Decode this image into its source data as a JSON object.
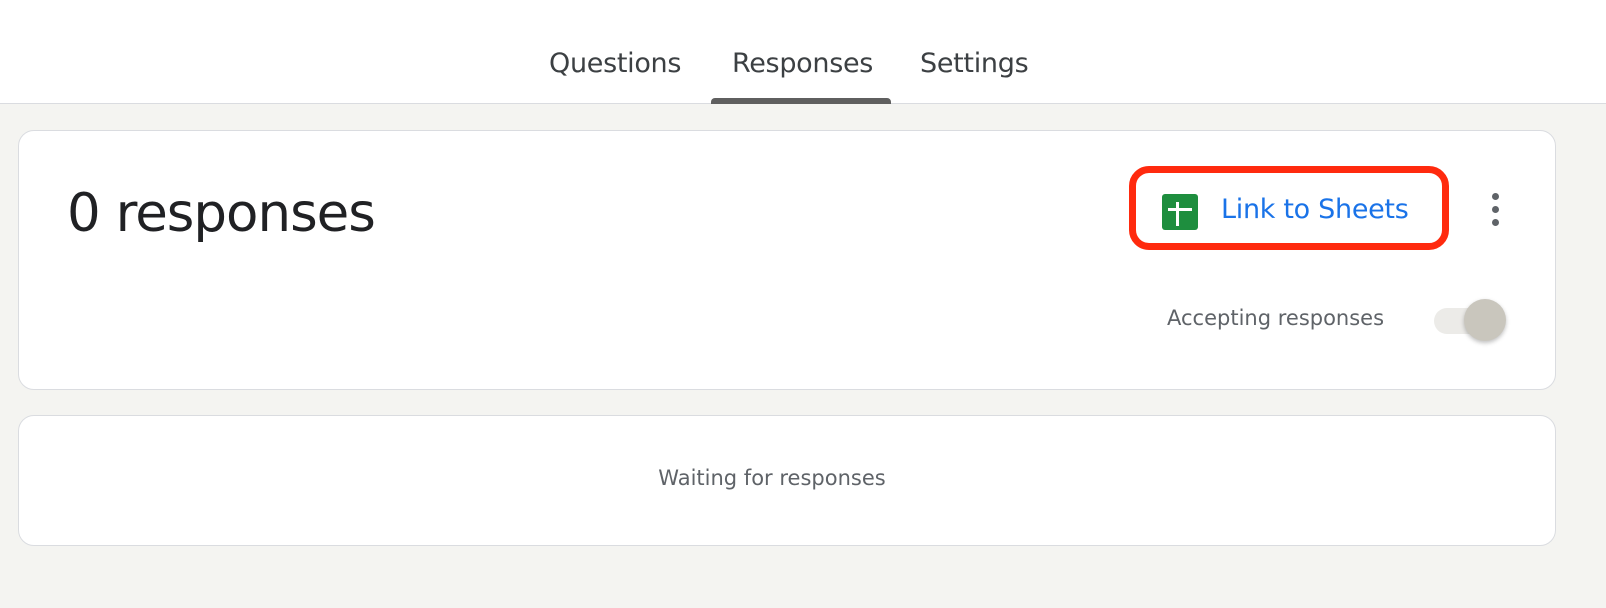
{
  "tabs": {
    "questions": "Questions",
    "responses": "Responses",
    "settings": "Settings",
    "active": "responses"
  },
  "summary": {
    "count_title": "0 responses",
    "link_sheets_label": "Link to Sheets",
    "more_icon": "more-vert-icon",
    "sheets_icon": "google-sheets-icon",
    "accepting_label": "Accepting responses",
    "accepting_toggle_state": "off"
  },
  "waiting": {
    "text": "Waiting for responses"
  },
  "colors": {
    "background": "#f4f4f1",
    "link_blue": "#1a73e8",
    "sheets_green": "#1e8e3e",
    "highlight_red": "#ff2a0e",
    "tab_indicator": "#5f5f5f"
  }
}
